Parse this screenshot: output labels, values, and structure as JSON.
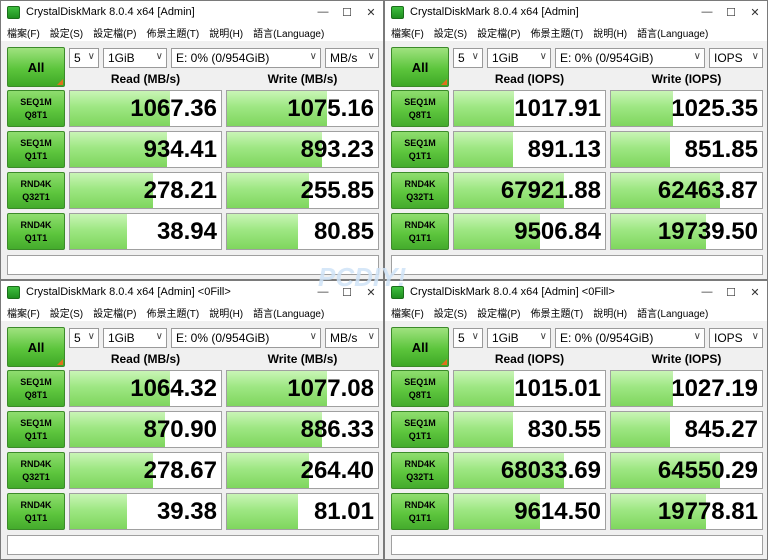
{
  "menu": [
    "檔案(F)",
    "設定(S)",
    "設定檔(P)",
    "佈景主題(T)",
    "說明(H)",
    "語言(Language)"
  ],
  "all_label": "All",
  "watermark": "PCDIY!",
  "colors": {
    "bar": "#7fd65e",
    "button": "#5ec63e"
  },
  "windows": [
    {
      "title": "CrystalDiskMark 8.0.4 x64 [Admin]",
      "count": "5",
      "size": "1GiB",
      "drive": "E: 0% (0/954GiB)",
      "unit": "MB/s",
      "read_header": "Read (MB/s)",
      "write_header": "Write (MB/s)",
      "rows": [
        {
          "l1": "SEQ1M",
          "l2": "Q8T1",
          "read": "1067.36",
          "write": "1075.16",
          "read_fill": 0.66,
          "write_fill": 0.66
        },
        {
          "l1": "SEQ1M",
          "l2": "Q1T1",
          "read": "934.41",
          "write": "893.23",
          "read_fill": 0.64,
          "write_fill": 0.63
        },
        {
          "l1": "RND4K",
          "l2": "Q32T1",
          "read": "278.21",
          "write": "255.85",
          "read_fill": 0.55,
          "write_fill": 0.54
        },
        {
          "l1": "RND4K",
          "l2": "Q1T1",
          "read": "38.94",
          "write": "80.85",
          "read_fill": 0.38,
          "write_fill": 0.47
        }
      ]
    },
    {
      "title": "CrystalDiskMark 8.0.4 x64 [Admin]",
      "count": "5",
      "size": "1GiB",
      "drive": "E: 0% (0/954GiB)",
      "unit": "IOPS",
      "read_header": "Read (IOPS)",
      "write_header": "Write (IOPS)",
      "rows": [
        {
          "l1": "SEQ1M",
          "l2": "Q8T1",
          "read": "1017.91",
          "write": "1025.35",
          "read_fill": 0.4,
          "write_fill": 0.41
        },
        {
          "l1": "SEQ1M",
          "l2": "Q1T1",
          "read": "891.13",
          "write": "851.85",
          "read_fill": 0.39,
          "write_fill": 0.39
        },
        {
          "l1": "RND4K",
          "l2": "Q32T1",
          "read": "67921.88",
          "write": "62463.87",
          "read_fill": 0.73,
          "write_fill": 0.72
        },
        {
          "l1": "RND4K",
          "l2": "Q1T1",
          "read": "9506.84",
          "write": "19739.50",
          "read_fill": 0.57,
          "write_fill": 0.63
        }
      ]
    },
    {
      "title": "CrystalDiskMark 8.0.4 x64 [Admin] <0Fill>",
      "count": "5",
      "size": "1GiB",
      "drive": "E: 0% (0/954GiB)",
      "unit": "MB/s",
      "read_header": "Read (MB/s)",
      "write_header": "Write (MB/s)",
      "rows": [
        {
          "l1": "SEQ1M",
          "l2": "Q8T1",
          "read": "1064.32",
          "write": "1077.08",
          "read_fill": 0.66,
          "write_fill": 0.66
        },
        {
          "l1": "SEQ1M",
          "l2": "Q1T1",
          "read": "870.90",
          "write": "886.33",
          "read_fill": 0.63,
          "write_fill": 0.63
        },
        {
          "l1": "RND4K",
          "l2": "Q32T1",
          "read": "278.67",
          "write": "264.40",
          "read_fill": 0.55,
          "write_fill": 0.54
        },
        {
          "l1": "RND4K",
          "l2": "Q1T1",
          "read": "39.38",
          "write": "81.01",
          "read_fill": 0.38,
          "write_fill": 0.47
        }
      ]
    },
    {
      "title": "CrystalDiskMark 8.0.4 x64 [Admin] <0Fill>",
      "count": "5",
      "size": "1GiB",
      "drive": "E: 0% (0/954GiB)",
      "unit": "IOPS",
      "read_header": "Read (IOPS)",
      "write_header": "Write (IOPS)",
      "rows": [
        {
          "l1": "SEQ1M",
          "l2": "Q8T1",
          "read": "1015.01",
          "write": "1027.19",
          "read_fill": 0.4,
          "write_fill": 0.41
        },
        {
          "l1": "SEQ1M",
          "l2": "Q1T1",
          "read": "830.55",
          "write": "845.27",
          "read_fill": 0.39,
          "write_fill": 0.39
        },
        {
          "l1": "RND4K",
          "l2": "Q32T1",
          "read": "68033.69",
          "write": "64550.29",
          "read_fill": 0.73,
          "write_fill": 0.72
        },
        {
          "l1": "RND4K",
          "l2": "Q1T1",
          "read": "9614.50",
          "write": "19778.81",
          "read_fill": 0.57,
          "write_fill": 0.63
        }
      ]
    }
  ]
}
